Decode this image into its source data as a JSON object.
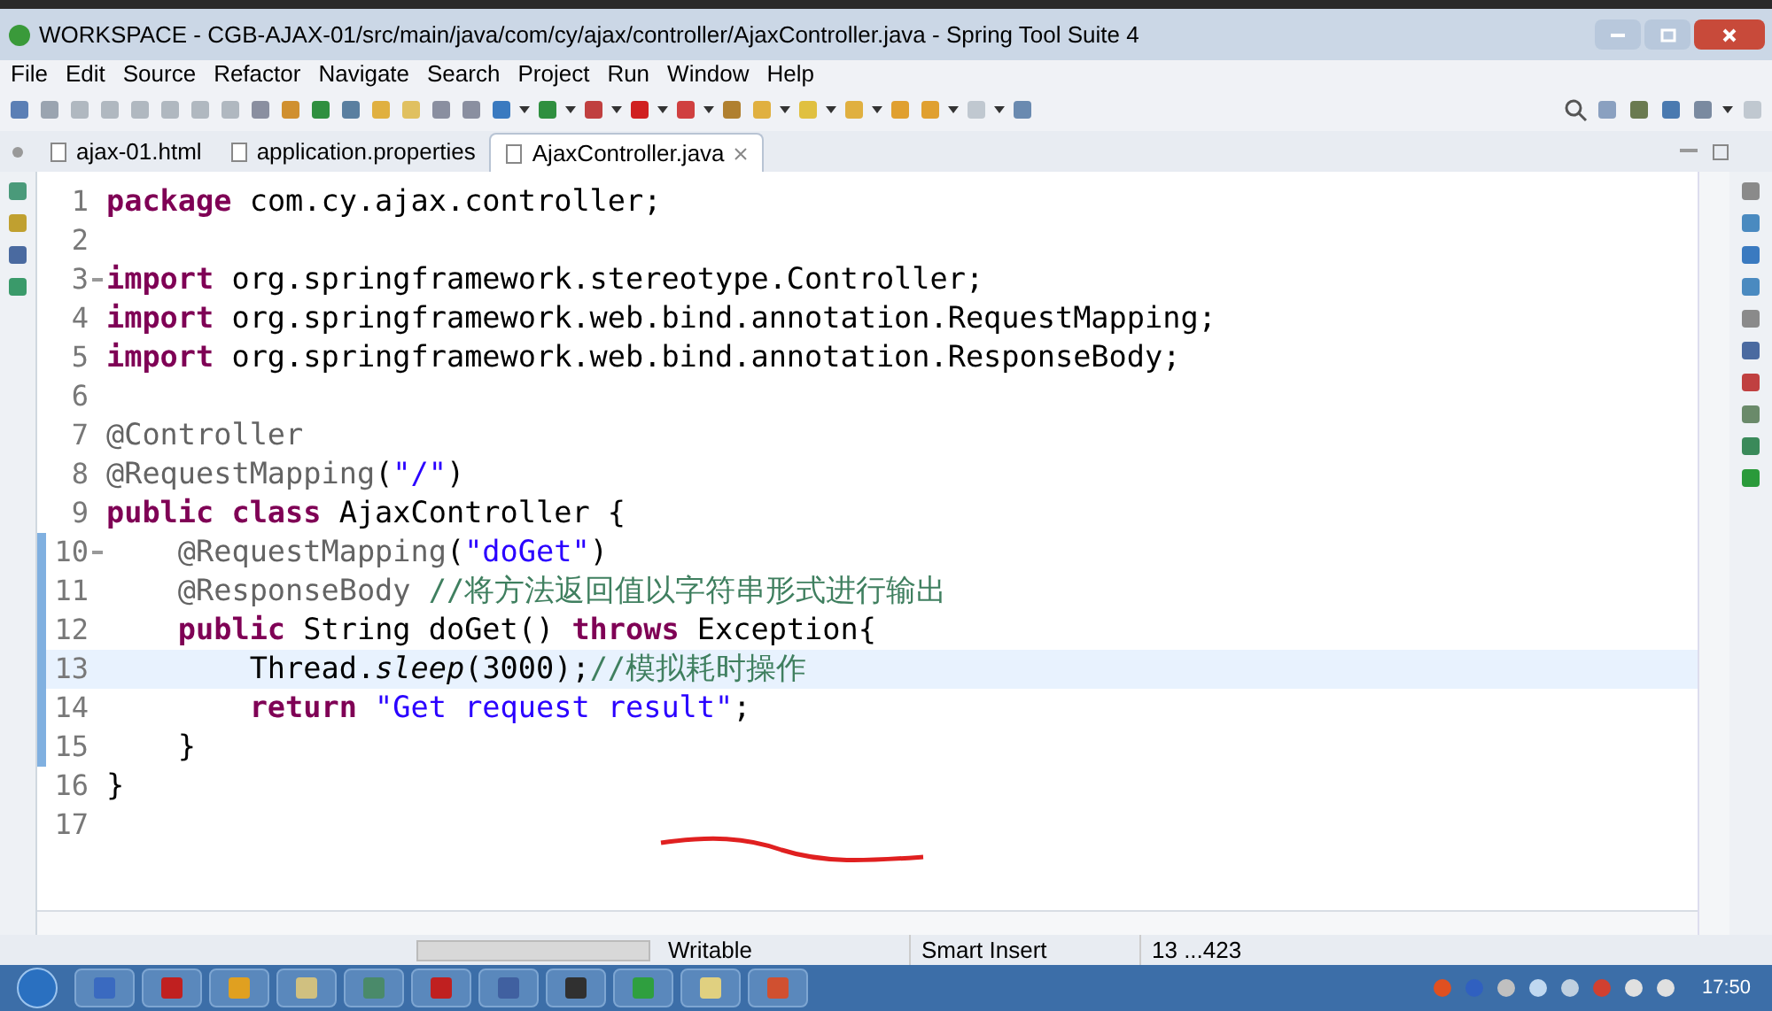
{
  "window": {
    "title": "WORKSPACE - CGB-AJAX-01/src/main/java/com/cy/ajax/controller/AjaxController.java - Spring Tool Suite 4"
  },
  "menu": [
    "File",
    "Edit",
    "Source",
    "Refactor",
    "Navigate",
    "Search",
    "Project",
    "Run",
    "Window",
    "Help"
  ],
  "tabs": [
    {
      "label": "ajax-01.html",
      "selected": false,
      "closable": false
    },
    {
      "label": "application.properties",
      "selected": false,
      "closable": false
    },
    {
      "label": "AjaxController.java",
      "selected": true,
      "closable": true
    }
  ],
  "editor": {
    "lines": [
      {
        "number": "1",
        "foldable": false,
        "changed": false,
        "selected": false,
        "tokens": [
          {
            "text": "package",
            "kind": "keyword"
          },
          {
            "text": " com.cy.ajax.controller;",
            "kind": "plain"
          }
        ]
      },
      {
        "number": "2",
        "foldable": false,
        "changed": false,
        "selected": false
      },
      {
        "number": "3",
        "foldable": true,
        "changed": false,
        "selected": false,
        "tokens": [
          {
            "text": "import",
            "kind": "keyword"
          },
          {
            "text": " org.springframework.stereotype.Controller;",
            "kind": "plain"
          }
        ]
      },
      {
        "number": "4",
        "foldable": false,
        "changed": false,
        "selected": false,
        "tokens": [
          {
            "text": "import",
            "kind": "keyword"
          },
          {
            "text": " org.springframework.web.bind.annotation.RequestMapping;",
            "kind": "plain"
          }
        ]
      },
      {
        "number": "5",
        "foldable": false,
        "changed": false,
        "selected": false,
        "tokens": [
          {
            "text": "import",
            "kind": "keyword"
          },
          {
            "text": " org.springframework.web.bind.annotation.ResponseBody;",
            "kind": "plain"
          }
        ]
      },
      {
        "number": "6",
        "foldable": false,
        "changed": false,
        "selected": false
      },
      {
        "number": "7",
        "foldable": false,
        "changed": false,
        "selected": false,
        "tokens": [
          {
            "text": "@Controller",
            "kind": "annotation"
          }
        ]
      },
      {
        "number": "8",
        "foldable": false,
        "changed": false,
        "selected": false,
        "tokens": [
          {
            "text": "@RequestMapping",
            "kind": "annotation"
          },
          {
            "text": "(",
            "kind": "plain"
          },
          {
            "text": "\"/\"",
            "kind": "string"
          },
          {
            "text": ")",
            "kind": "plain"
          }
        ]
      },
      {
        "number": "9",
        "foldable": false,
        "changed": false,
        "selected": false,
        "tokens": [
          {
            "text": "public class",
            "kind": "keyword"
          },
          {
            "text": " AjaxController {",
            "kind": "plain"
          }
        ]
      },
      {
        "number": "10",
        "foldable": true,
        "changed": true,
        "selected": false,
        "tokens": [
          {
            "text": "    @RequestMapping",
            "kind": "annotation"
          },
          {
            "text": "(",
            "kind": "plain"
          },
          {
            "text": "\"doGet\"",
            "kind": "string"
          },
          {
            "text": ")",
            "kind": "plain"
          }
        ]
      },
      {
        "number": "11",
        "foldable": false,
        "changed": true,
        "selected": false,
        "tokens": [
          {
            "text": "    @ResponseBody",
            "kind": "annotation"
          },
          {
            "text": " //将方法返回值以字符串形式进行输出",
            "kind": "comment"
          }
        ]
      },
      {
        "number": "12",
        "foldable": false,
        "changed": true,
        "selected": false,
        "tokens": [
          {
            "text": "    public",
            "kind": "keyword"
          },
          {
            "text": " String doGet() ",
            "kind": "plain"
          },
          {
            "text": "throws",
            "kind": "keyword"
          },
          {
            "text": " Exception{",
            "kind": "plain"
          }
        ]
      },
      {
        "number": "13",
        "foldable": false,
        "changed": true,
        "selected": true,
        "tokens": [
          {
            "text": "        Thread.",
            "kind": "plain"
          },
          {
            "text": "sleep",
            "kind": "static"
          },
          {
            "text": "(3000);",
            "kind": "plain"
          },
          {
            "text": "//模拟耗时操作",
            "kind": "comment"
          }
        ]
      },
      {
        "number": "14",
        "foldable": false,
        "changed": true,
        "selected": false,
        "tokens": [
          {
            "text": "        return",
            "kind": "keyword"
          },
          {
            "text": " \"Get request result\"",
            "kind": "string"
          },
          {
            "text": ";",
            "kind": "plain"
          }
        ]
      },
      {
        "number": "15",
        "foldable": false,
        "changed": true,
        "selected": false,
        "tokens": [
          {
            "text": "    }",
            "kind": "plain"
          }
        ]
      },
      {
        "number": "16",
        "foldable": false,
        "changed": false,
        "selected": false,
        "tokens": [
          {
            "text": "}",
            "kind": "plain"
          }
        ]
      },
      {
        "number": "17",
        "foldable": false,
        "changed": false,
        "selected": false
      }
    ]
  },
  "status_bar": [
    "Writable",
    "Smart Insert",
    "13 ...423"
  ],
  "taskbar": {
    "clock": "17:50"
  }
}
